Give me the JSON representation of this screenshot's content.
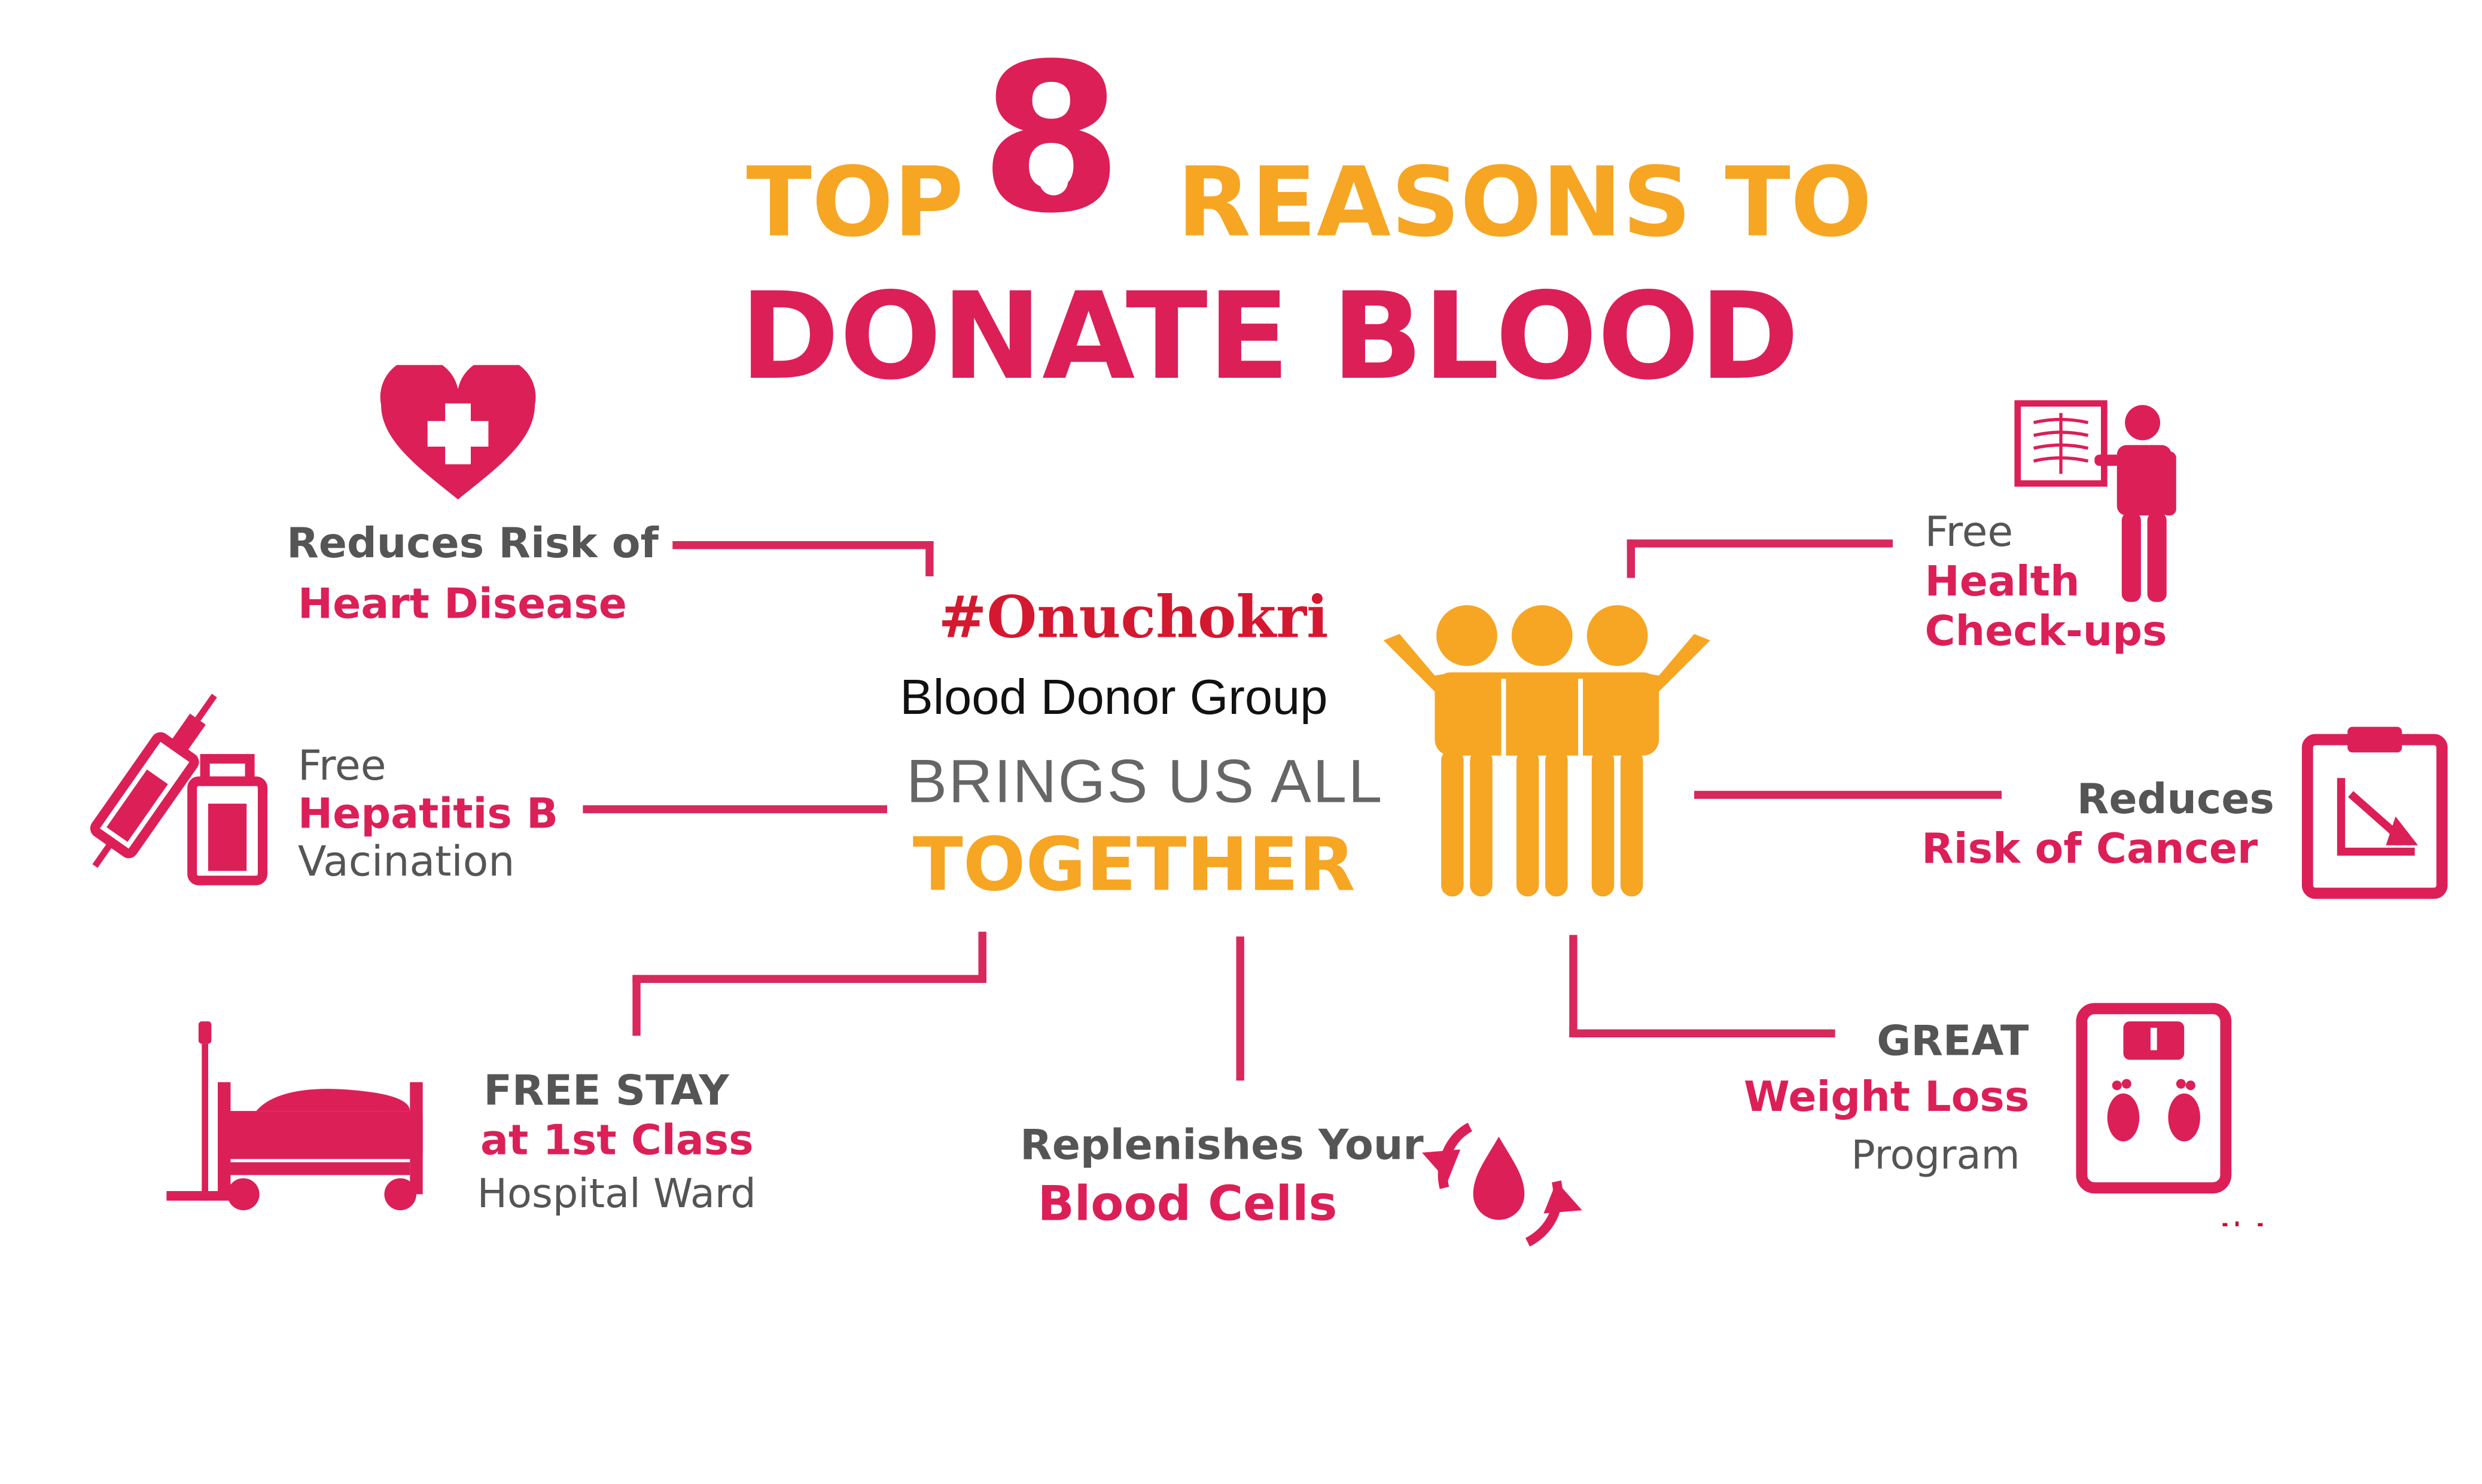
{
  "title": {
    "top": "TOP",
    "number": "8",
    "reasons_to": "REASONS TO",
    "donate_blood": "DONATE BLOOD"
  },
  "center": {
    "brand": "#Onuchokri",
    "group_name": "Blood Donor Group",
    "brings": "BRINGS US ALL",
    "together": "TOGETHER"
  },
  "reasons": [
    {
      "lines": [
        "Reduces Risk of",
        "Heart Disease"
      ],
      "icon": "heart-plus-icon"
    },
    {
      "lines": [
        "Free",
        "Hepatitis B",
        "Vacination"
      ],
      "icon": "syringe-bottle-icon"
    },
    {
      "lines": [
        "FREE STAY",
        "at 1st Class",
        "Hospital Ward"
      ],
      "icon": "hospital-bed-icon"
    },
    {
      "lines": [
        "Replenishes Your",
        "Blood Cells"
      ],
      "icon": "blood-drop-cycle-icon"
    },
    {
      "lines": [
        "GREAT",
        "Weight Loss",
        "Program"
      ],
      "icon": "weighing-scale-icon"
    },
    {
      "lines": [
        "Reduces",
        "Risk of Cancer"
      ],
      "icon": "clipboard-chart-icon"
    },
    {
      "lines": [
        "Free",
        "Health",
        "Check-ups"
      ],
      "icon": "doctor-xray-icon"
    }
  ],
  "people_icon": "group-people-icon",
  "colors": {
    "pink": "#dc1f57",
    "orange": "#f6a623",
    "gray": "#555555",
    "brand_red": "#d4182f"
  }
}
